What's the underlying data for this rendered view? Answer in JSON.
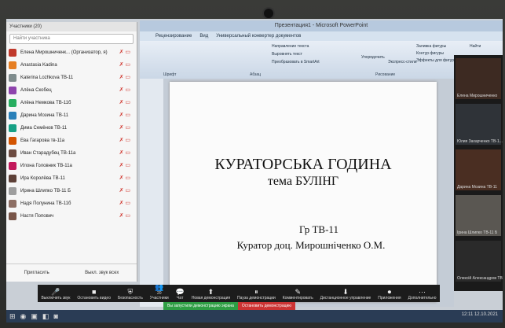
{
  "ppt": {
    "title": "Презентация1 - Microsoft PowerPoint",
    "tabs": [
      "Рецензирование",
      "Вид",
      "Универсальный конвертер документов"
    ],
    "ribbon_items": [
      "Направление текста",
      "Выровнять текст",
      "Преобразовать в SmartArt",
      "Заливка фигуры",
      "Контур фигуры",
      "Эффекты для фигур",
      "Упорядочить",
      "Экспресс-стили"
    ],
    "ribbon_groups": [
      "Шрифт",
      "Абзац",
      "Рисование"
    ],
    "find_label": "Найти"
  },
  "slide": {
    "line1": "КУРАТОРСЬКА ГОДИНА",
    "line2": "тема  БУЛІНГ",
    "line3": "Гр ТВ-11",
    "line4": "Куратор доц. Мирошніченко О.М."
  },
  "participants": {
    "header": "Участники (20)",
    "search_placeholder": "Найти участника",
    "list": [
      {
        "name": "Елена Мирошниченк... (Организатор, я)",
        "color": "#c0392b"
      },
      {
        "name": "Anastasia Kadina",
        "color": "#e67e22"
      },
      {
        "name": "Katerina Lozhkova ТВ-11",
        "color": "#7f8c8d"
      },
      {
        "name": "Алёна Скобец",
        "color": "#8e44ad"
      },
      {
        "name": "Алёна Немкова ТВ-11б",
        "color": "#27ae60"
      },
      {
        "name": "Дарина Мозина ТВ-11",
        "color": "#2980b9"
      },
      {
        "name": "Дима Семёнов ТВ-11",
        "color": "#16a085"
      },
      {
        "name": "Ева Гагарова тв-11а",
        "color": "#d35400"
      },
      {
        "name": "Иван Старадубец ТВ-11а",
        "color": "#6d4c41"
      },
      {
        "name": "Илона Головник ТВ-11а",
        "color": "#c2185b"
      },
      {
        "name": "Ира Королёва ТВ-11",
        "color": "#5d4037"
      },
      {
        "name": "Ирина Шлипко ТВ-11 Б",
        "color": "#9e9e9e"
      },
      {
        "name": "Надя Полунина ТВ-11б",
        "color": "#8d6e63"
      },
      {
        "name": "Настя Попович",
        "color": "#795548"
      }
    ],
    "invite_label": "Пригласить",
    "mute_all_label": "Выкл. звук всех"
  },
  "videos": [
    {
      "name": "Елена Мирошниченко"
    },
    {
      "name": "Юлия Захарченко ТВ-1..."
    },
    {
      "name": "Дарина Мозина ТВ-11"
    },
    {
      "name": "Ірина Шлипко ТВ-11 Б"
    },
    {
      "name": "Олексій Александров ТВ-11"
    }
  ],
  "toolbar": {
    "items": [
      {
        "icon": "🎤",
        "label": "Выключить звук"
      },
      {
        "icon": "■",
        "label": "Остановить видео"
      },
      {
        "icon": "⛨",
        "label": "Безопасность"
      },
      {
        "icon": "👥",
        "label": "Участники"
      },
      {
        "icon": "💬",
        "label": "Чат"
      },
      {
        "icon": "⬆",
        "label": "Новая демонстрация"
      },
      {
        "icon": "⏸",
        "label": "Пауза демонстрации"
      },
      {
        "icon": "✎",
        "label": "Комментировать"
      },
      {
        "icon": "⬇",
        "label": "Дистанционное управление"
      },
      {
        "icon": "⏺",
        "label": "Приложения"
      },
      {
        "icon": "⋯",
        "label": "Дополнительно"
      }
    ],
    "participants_count": "20",
    "sharing_text": "Вы запустили демонстрацию экрана",
    "stop_share_label": "Остановить демонстрацию"
  },
  "taskbar": {
    "time": "12:11",
    "date": "12.10.2021"
  }
}
